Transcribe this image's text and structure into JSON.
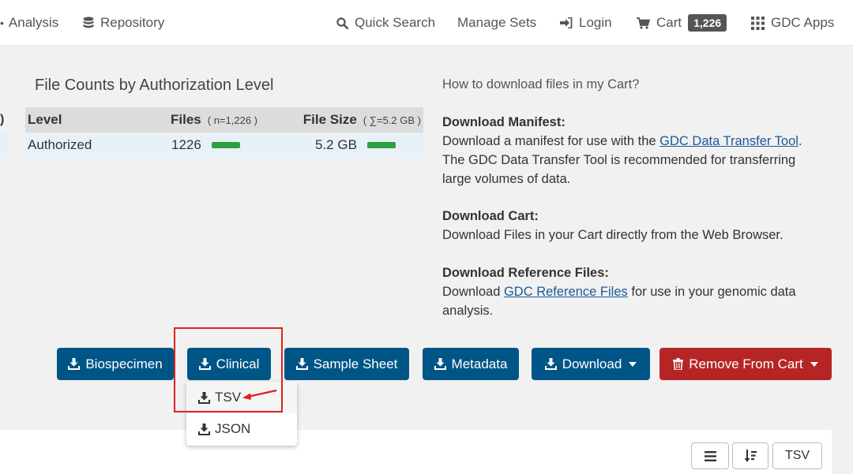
{
  "nav": {
    "analysis": "Analysis",
    "repository": "Repository",
    "quick_search": "Quick Search",
    "manage_sets": "Manage Sets",
    "login": "Login",
    "cart": "Cart",
    "cart_count": "1,226",
    "gdc_apps": "GDC Apps"
  },
  "file_counts": {
    "title": "File Counts by Authorization Level",
    "left_edge_fragment": ")",
    "headers": {
      "level": "Level",
      "files": "Files",
      "files_sub": "( n=1,226 )",
      "size": "File Size",
      "size_sub": "( ∑=5.2 GB )"
    },
    "rows": [
      {
        "level": "Authorized",
        "files": "1226",
        "size": "5.2 GB",
        "files_fraction": 1.0,
        "size_fraction": 1.0
      }
    ],
    "bar_color": "#2ea043"
  },
  "help": {
    "question": "How to download files in my Cart?",
    "manifest_title": "Download Manifest:",
    "manifest_l1_pre": "Download a manifest for use with the ",
    "manifest_link": "GDC Data Transfer Tool",
    "manifest_l1_post": ".",
    "manifest_l2": "The GDC Data Transfer Tool is recommended for transferring",
    "manifest_l3": "large volumes of data.",
    "cart_title": "Download Cart:",
    "cart_text": "Download Files in your Cart directly from the Web Browser.",
    "ref_title": "Download Reference Files:",
    "ref_l1_pre": "Download ",
    "ref_link": "GDC Reference Files",
    "ref_l1_post": " for use in your genomic data",
    "ref_l2": "analysis."
  },
  "buttons": {
    "biospecimen": "Biospecimen",
    "clinical": "Clinical",
    "sample_sheet": "Sample Sheet",
    "metadata": "Metadata",
    "download": "Download",
    "remove": "Remove From Cart"
  },
  "dropdown": {
    "tsv": "TSV",
    "json": "JSON"
  },
  "toolbar": {
    "tsv": "TSV"
  },
  "colors": {
    "primary": "#005587",
    "danger": "#b52525",
    "highlight": "#e02020"
  }
}
